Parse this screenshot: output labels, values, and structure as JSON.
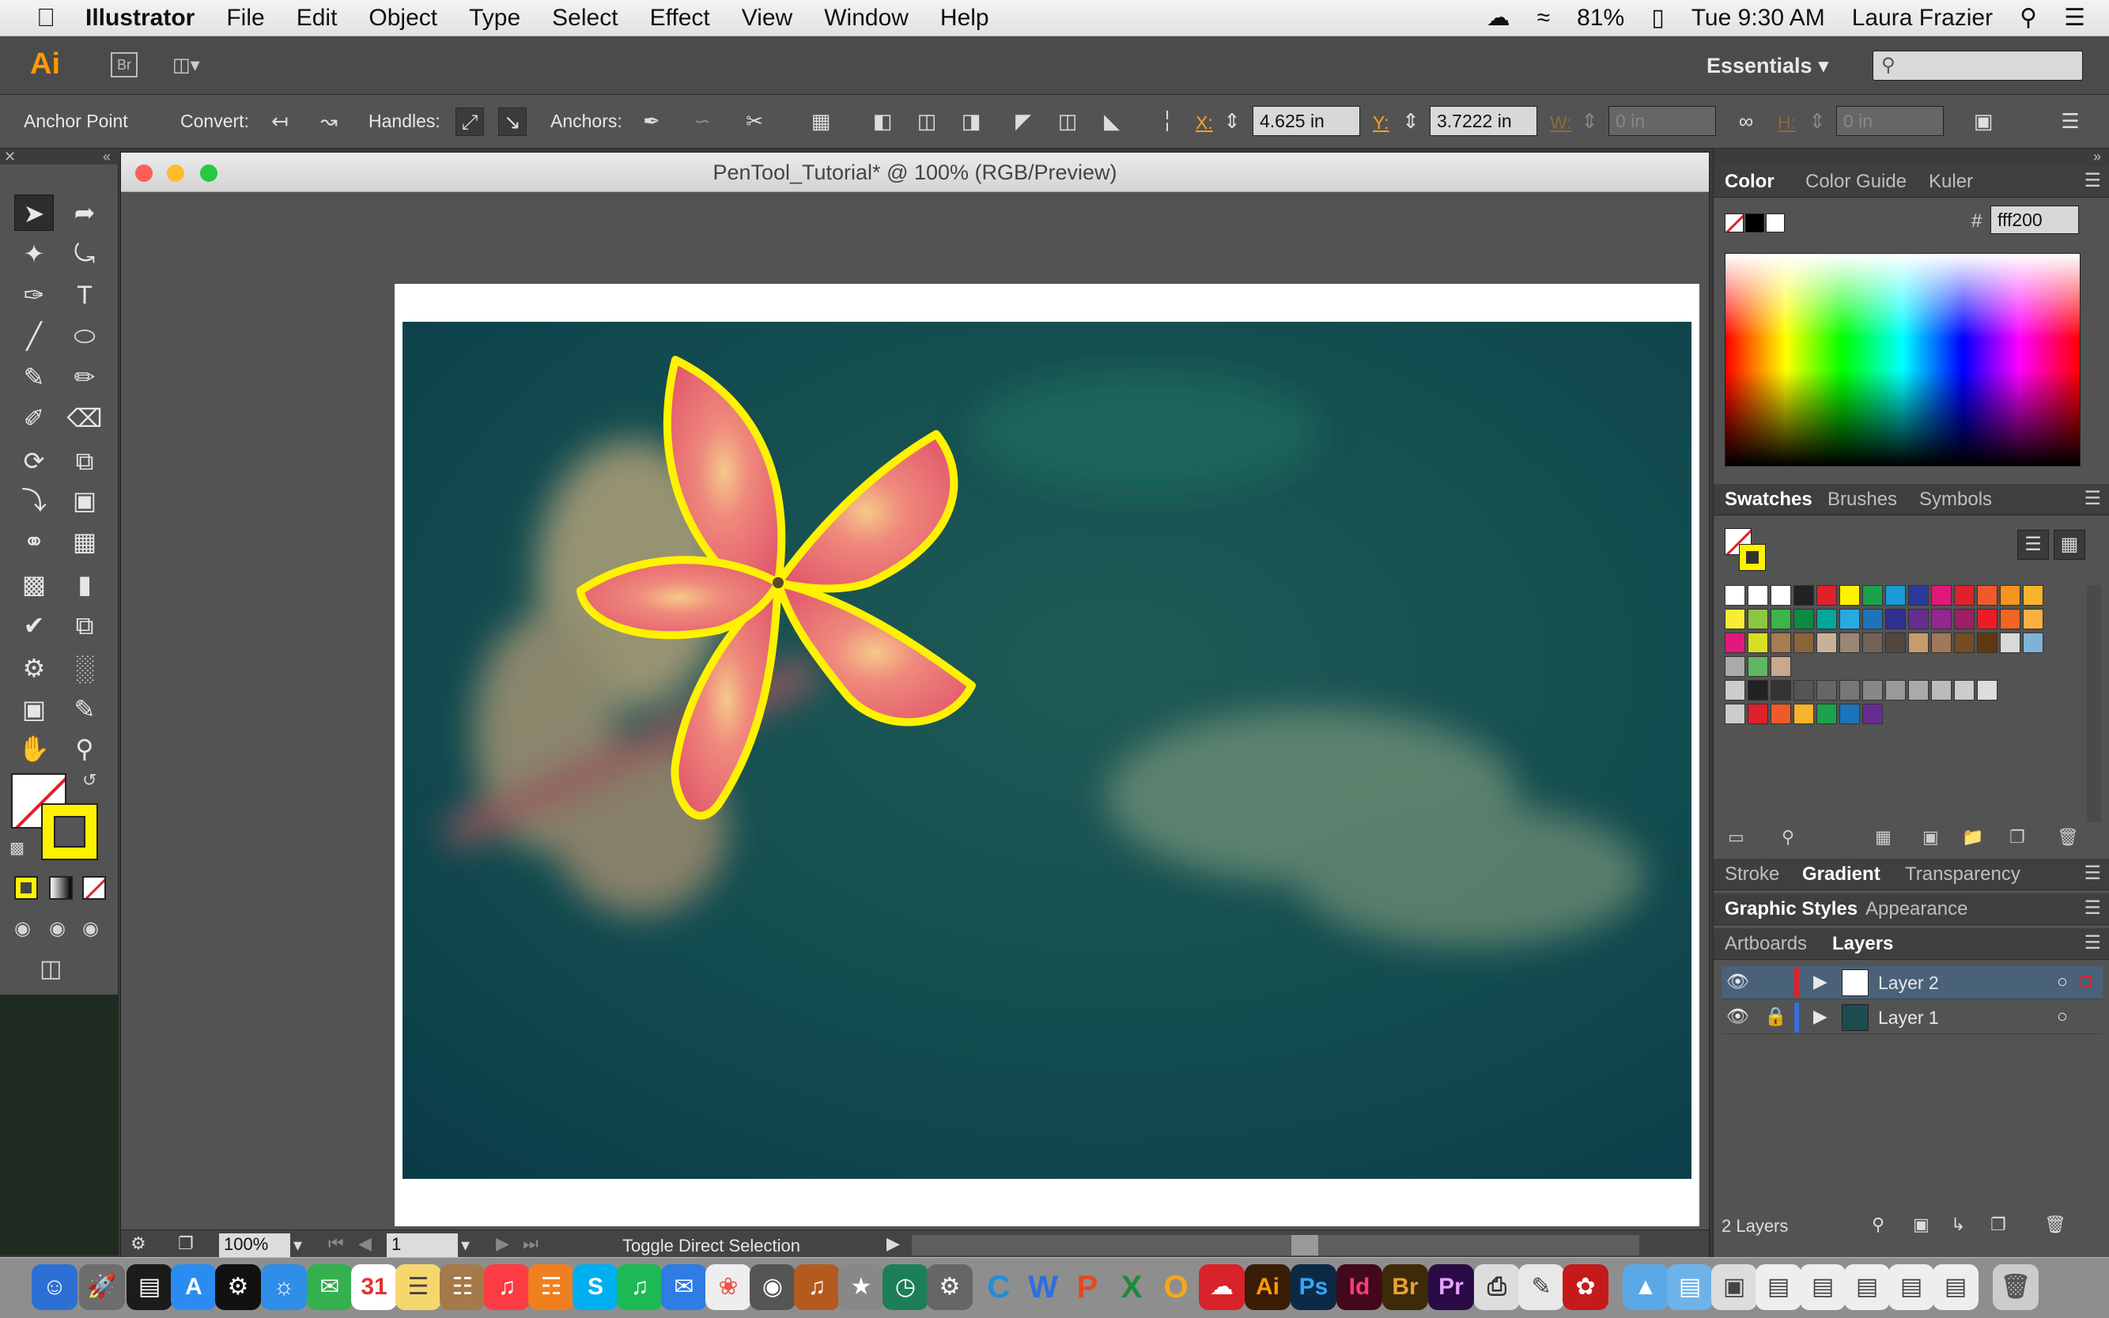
{
  "menubar": {
    "app_name": "Illustrator",
    "items": [
      "File",
      "Edit",
      "Object",
      "Type",
      "Select",
      "Effect",
      "View",
      "Window",
      "Help"
    ],
    "battery": "81%",
    "clock": "Tue 9:30 AM",
    "user": "Laura Frazier"
  },
  "appbar": {
    "logo": "Ai",
    "bridge": "Br",
    "workspace": "Essentials"
  },
  "control": {
    "tool_name": "Anchor Point",
    "convert_label": "Convert:",
    "handles_label": "Handles:",
    "anchors_label": "Anchors:",
    "x_label": "X:",
    "x_value": "4.625 in",
    "y_label": "Y:",
    "y_value": "3.7222 in",
    "w_label": "W:",
    "w_value": "0 in",
    "h_label": "H:",
    "h_value": "0 in"
  },
  "document": {
    "title": "PenTool_Tutorial* @ 100% (RGB/Preview)",
    "zoom": "100%",
    "page": "1",
    "status": "Toggle Direct Selection"
  },
  "panels": {
    "color_tabs": [
      "Color",
      "Color Guide",
      "Kuler"
    ],
    "hex_prefix": "#",
    "hex_value": "fff200",
    "swatch_tabs": [
      "Swatches",
      "Brushes",
      "Symbols"
    ],
    "stroke_tabs": [
      "Stroke",
      "Gradient",
      "Transparency"
    ],
    "style_tabs": [
      "Graphic Styles",
      "Appearance"
    ],
    "layer_tabs": [
      "Artboards",
      "Layers"
    ],
    "layers": [
      {
        "name": "Layer 2",
        "color": "#e0202a"
      },
      {
        "name": "Layer 1",
        "color": "#3b6fe0"
      }
    ],
    "layer_count": "2 Layers"
  },
  "colors": {
    "accent_stroke": "#fff200",
    "selection_blue": "#49627a"
  },
  "dock": {
    "labels": [
      "Ai",
      "Ps",
      "Id",
      "Br",
      "Pr",
      "C",
      "W"
    ]
  }
}
